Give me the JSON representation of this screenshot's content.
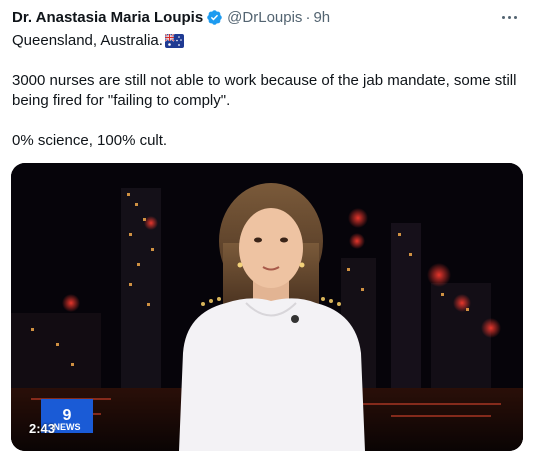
{
  "tweet": {
    "display_name": "Dr. Anastasia Maria Loupis",
    "handle": "@DrLoupis",
    "separator": "·",
    "time": "9h",
    "location_line": "Queensland, Australia.",
    "paragraph_1": "3000 nurses are still not able to work because of the jab mandate, some still being fired for \"failing to comply\".",
    "paragraph_2": "0% science, 100% cult."
  },
  "media": {
    "video_timestamp": "2:43",
    "channel_logo_text": "9NEWS",
    "logo_color": "#1a5bd6"
  },
  "icons": {
    "verified": "verified-badge-icon",
    "more": "more-options-icon",
    "flag": "australia-flag-icon"
  },
  "colors": {
    "text_primary": "#0f1419",
    "text_secondary": "#536471",
    "verified_blue": "#1d9bf0"
  }
}
